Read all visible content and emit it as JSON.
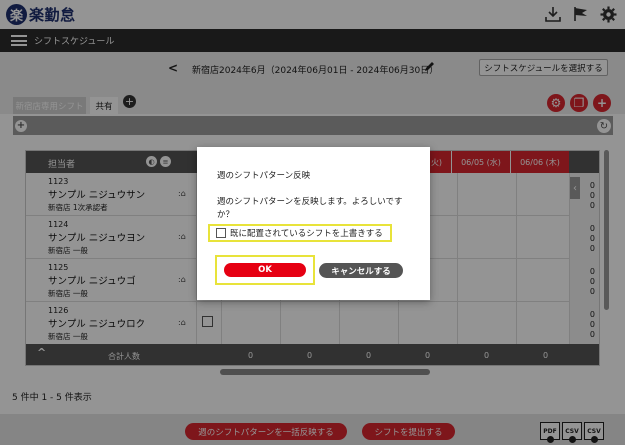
{
  "app": {
    "logo_mark": "楽",
    "logo_text": "楽勤怠"
  },
  "topbar": {
    "icons": [
      "download-icon",
      "flag-icon",
      "gear-icon"
    ]
  },
  "nav": {
    "title": "シフトスケジュール"
  },
  "period": {
    "prev": "<",
    "text": "新宿店2024年6月（2024年06月01日 - 2024年06月30日）",
    "select_button": "シフトスケジュールを選択する"
  },
  "tabs": {
    "active": "新宿店専用シフト",
    "shared": "共有",
    "add": "+"
  },
  "grid": {
    "header_name": "担当者",
    "dates": [
      "火)",
      "06/05 (水)",
      "06/06 (木)"
    ],
    "employees": [
      {
        "id": "1123",
        "name": "サンプル ニジュウサン",
        "role": "新宿店 1次承認者"
      },
      {
        "id": "1124",
        "name": "サンプル ニジュウヨン",
        "role": "新宿店 一般"
      },
      {
        "id": "1125",
        "name": "サンプル ニジュウゴ",
        "role": "新宿店 一般"
      },
      {
        "id": "1126",
        "name": "サンプル ニジュウロク",
        "role": "新宿店 一般"
      }
    ],
    "side_values": [
      "0",
      "0",
      "0",
      "0",
      "0",
      "0",
      "0",
      "0",
      "0",
      "0",
      "0",
      "0"
    ],
    "total_label": "合計人数",
    "total_values": [
      "0",
      "0",
      "0",
      "0",
      "0",
      "0"
    ]
  },
  "list": {
    "count_text": "5 件中 1 - 5 件表示"
  },
  "footer": {
    "bulk_button": "週のシフトパターンを一括反映する",
    "submit_button": "シフトを提出する",
    "files": [
      "PDF",
      "CSV",
      "CSV"
    ]
  },
  "dialog": {
    "title": "週のシフトパターン反映",
    "message": "週のシフトパターンを反映します。よろしいですか？",
    "checkbox_label": "既に配置されているシフトを上書きする",
    "ok": "OK",
    "cancel": "キャンセルする"
  },
  "colors": {
    "accent": "#d9262f",
    "highlight": "#e8e33a",
    "brand": "#1e2f6e"
  }
}
